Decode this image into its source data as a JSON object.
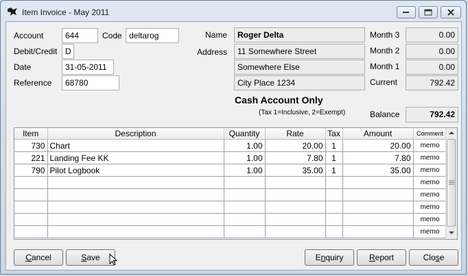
{
  "window": {
    "title": "Item Invoice - May 2011"
  },
  "form": {
    "account_label": "Account",
    "account_value": "644",
    "code_label": "Code",
    "code_value": "deltarog",
    "debit_credit_label": "Debit/Credit",
    "debit_credit_value": "D",
    "date_label": "Date",
    "date_value": "31-05-2011",
    "reference_label": "Reference",
    "reference_value": "68780",
    "name_label": "Name",
    "name_value": "Roger Delta",
    "address_label": "Address",
    "address_line1": "11 Somewhere Street",
    "address_line2": "Somewhere Else",
    "address_line3": "City Place 1234",
    "cash_account_text": "Cash Account Only",
    "tax_hint": "(Tax 1=Inclusive, 2=Exempt)"
  },
  "balances": {
    "month3_label": "Month 3",
    "month3_value": "0.00",
    "month2_label": "Month 2",
    "month2_value": "0.00",
    "month1_label": "Month 1",
    "month1_value": "0.00",
    "current_label": "Current",
    "current_value": "792.42",
    "balance_label": "Balance",
    "balance_value": "792.42"
  },
  "table": {
    "headers": [
      "Item",
      "Description",
      "Quantity",
      "Rate",
      "Tax",
      "Amount",
      "Comment"
    ],
    "rows": [
      [
        "730",
        "Chart",
        "1.00",
        "20.00",
        "1",
        "20.00",
        "memo"
      ],
      [
        "221",
        "Landing Fee KK",
        "1.00",
        "7.80",
        "1",
        "7.80",
        "memo"
      ],
      [
        "790",
        "Pilot Logbook",
        "1.00",
        "35.00",
        "1",
        "35.00",
        "memo"
      ],
      [
        "",
        "",
        "",
        "",
        "",
        "",
        "memo"
      ],
      [
        "",
        "",
        "",
        "",
        "",
        "",
        "memo"
      ],
      [
        "",
        "",
        "",
        "",
        "",
        "",
        "memo"
      ],
      [
        "",
        "",
        "",
        "",
        "",
        "",
        "memo"
      ],
      [
        "",
        "",
        "",
        "",
        "",
        "",
        "memo"
      ]
    ]
  },
  "buttons": {
    "cancel_pre": "",
    "cancel_key": "C",
    "cancel_post": "ancel",
    "save_pre": "",
    "save_key": "S",
    "save_post": "ave",
    "enquiry_pre": "E",
    "enquiry_key": "n",
    "enquiry_post": "quiry",
    "report_pre": "",
    "report_key": "R",
    "report_post": "eport",
    "close_pre": "Clo",
    "close_key": "s",
    "close_post": "e"
  }
}
